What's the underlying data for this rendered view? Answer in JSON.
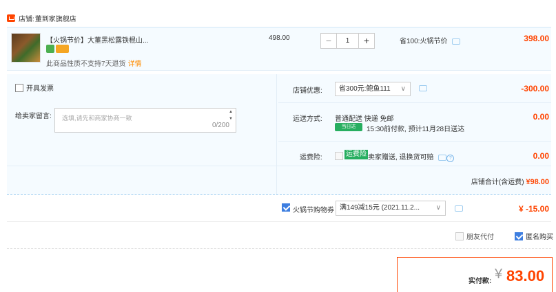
{
  "shop": {
    "label": "店铺:",
    "name": "董到家旗舰店"
  },
  "item": {
    "title": "【火锅节价】大董黑松露铁棍山...",
    "note": "此商品性质不支持7天退货",
    "note_link": "详情",
    "unit_price": "498.00",
    "quantity": "1",
    "saving": "省100:火锅节价",
    "subtotal": "398.00"
  },
  "invoice": {
    "label": "开具发票"
  },
  "message": {
    "label": "给卖家留言:",
    "placeholder": "选填,请先和商家协商一致",
    "count": "0/200"
  },
  "shop_discount": {
    "label": "店铺优惠:",
    "selected": "省300元:鲍鱼111",
    "value": "-300.00"
  },
  "shipping": {
    "label": "运送方式:",
    "method": "普通配送 快递 免邮",
    "tag": "当日达",
    "detail": "15:30前付款, 预计11月28日送达",
    "value": "0.00"
  },
  "insurance": {
    "label": "运费险:",
    "tag": "运费险",
    "text": "卖家赠送, 退换货可赔",
    "value": "0.00"
  },
  "shop_total": {
    "label": "店铺合计(含运费)",
    "value": "¥98.00"
  },
  "coupon": {
    "label": "火锅节购物券",
    "selected": "满149减15元 (2021.11.2...",
    "value": "¥ -15.00"
  },
  "options": {
    "friend_pay": "朋友代付",
    "anonymous": "匿名购买"
  },
  "payment": {
    "label": "实付款:",
    "currency": "¥",
    "amount": "83.00"
  }
}
